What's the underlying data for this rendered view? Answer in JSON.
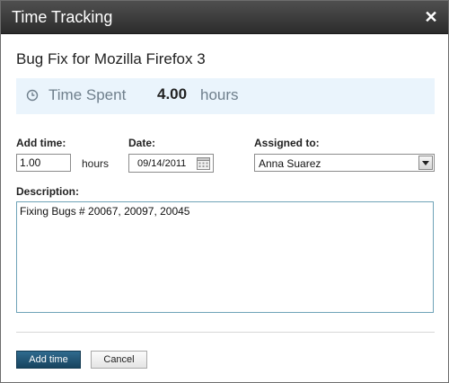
{
  "dialog": {
    "title": "Time Tracking",
    "close_icon": "close-icon"
  },
  "task": {
    "title": "Bug Fix for Mozilla Firefox 3"
  },
  "time_spent": {
    "icon": "clock-icon",
    "label": "Time Spent",
    "value": "4.00",
    "unit": "hours"
  },
  "form": {
    "add_time": {
      "label": "Add time:",
      "value": "1.00",
      "unit": "hours"
    },
    "date": {
      "label": "Date:",
      "value": "09/14/2011",
      "icon": "calendar-icon"
    },
    "assigned_to": {
      "label": "Assigned to:",
      "value": "Anna Suarez"
    },
    "description": {
      "label": "Description:",
      "value": "Fixing Bugs # 20067, 20097, 20045"
    }
  },
  "buttons": {
    "add_time": "Add time",
    "cancel": "Cancel"
  },
  "colors": {
    "titlebar": "#3a3a3a",
    "banner": "#eaf4fc",
    "primary_button": "#1f5473"
  }
}
